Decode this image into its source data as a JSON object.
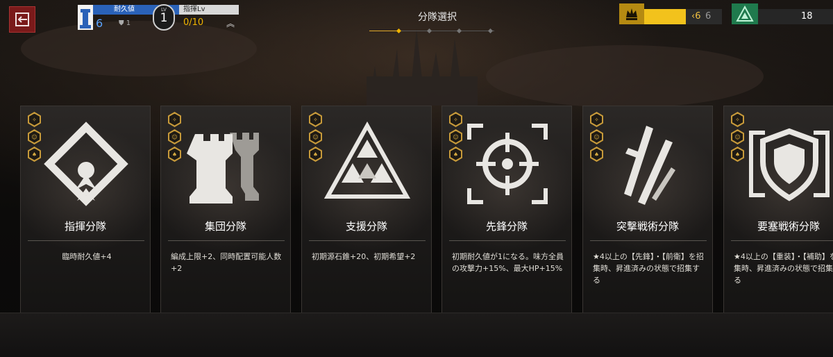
{
  "header": {
    "exit_icon": "exit-icon",
    "durability_label": "耐久値",
    "durability_value": "6",
    "shield_value": "1",
    "level_label": "LV",
    "level_value": "1",
    "command_label": "指揮Lv",
    "command_value": "0/10",
    "page_title": "分隊選択",
    "rank_current": "6",
    "rank_max": "6",
    "origin_value": "18"
  },
  "colors": {
    "accent_gold": "#c79a3a",
    "durability_blue": "#2a62b8",
    "command_orange": "#f0b400",
    "origin_green": "#1f7a4d"
  },
  "cards": [
    {
      "name": "指揮分隊",
      "desc": "臨時耐久値+4",
      "icon": "command-squad-emblem"
    },
    {
      "name": "集団分隊",
      "desc": "編成上限+2、同時配置可能人数+2",
      "icon": "collective-squad-emblem"
    },
    {
      "name": "支援分隊",
      "desc": "初期源石錐+20、初期希望+2",
      "icon": "support-squad-emblem"
    },
    {
      "name": "先鋒分隊",
      "desc": "初期耐久値が1になる。味方全員の攻撃力+15%、最大HP+15%",
      "icon": "vanguard-squad-emblem"
    },
    {
      "name": "突撃戦術分隊",
      "desc": "★4以上の【先鋒】・【前衛】を招集時、昇進済みの状態で招集する",
      "icon": "assault-tactics-emblem"
    },
    {
      "name": "要塞戦術分隊",
      "desc": "★4以上の【重装】・【補助】を招集時、昇進済みの状態で招集する",
      "icon": "fortress-tactics-emblem"
    }
  ]
}
